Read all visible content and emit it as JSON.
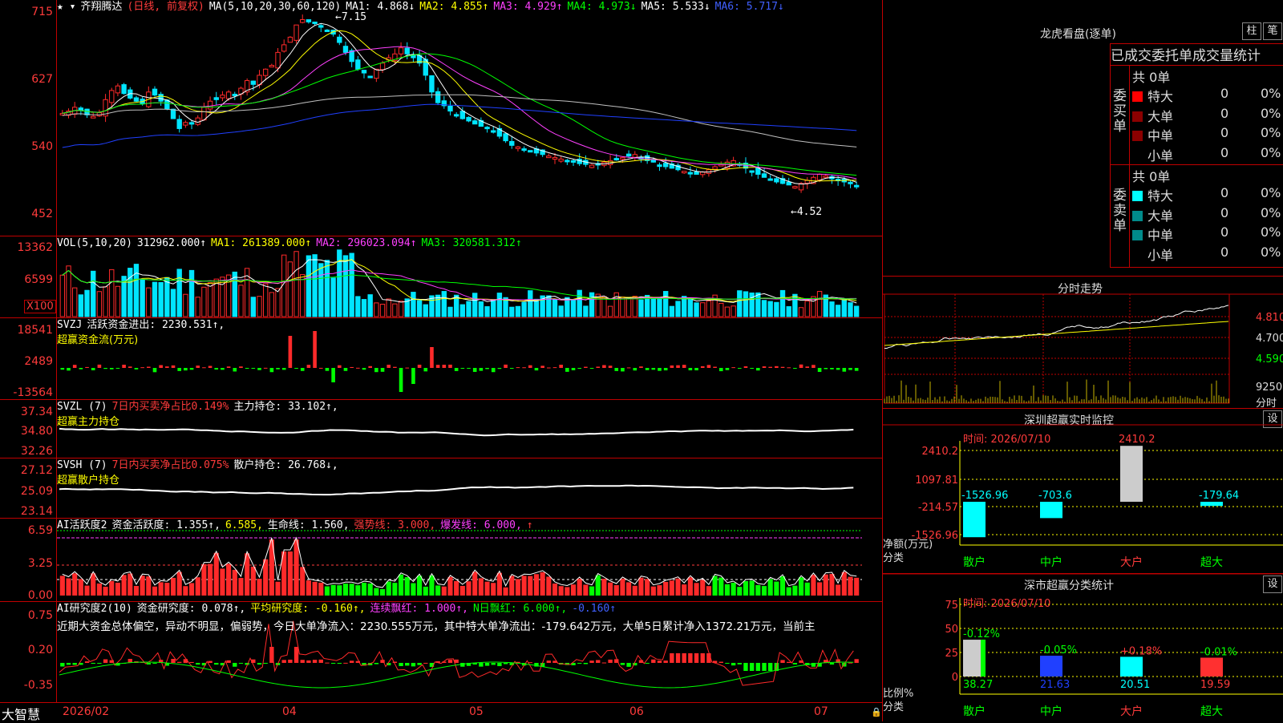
{
  "colors": {
    "up": "#ff2a2a",
    "down": "#00e5ff",
    "border": "#c00000"
  },
  "chart_data": [
    {
      "type": "candlestick",
      "panel": "price",
      "ylim": [
        452,
        715
      ],
      "yticks": [
        "715",
        "627",
        "540",
        "452"
      ],
      "close": [
        582,
        585,
        590,
        586,
        580,
        578,
        583,
        600,
        612,
        618,
        608,
        602,
        598,
        595,
        610,
        606,
        598,
        588,
        575,
        562,
        570,
        568,
        576,
        590,
        598,
        600,
        606,
        610,
        605,
        615,
        625,
        620,
        632,
        640,
        645,
        662,
        672,
        682,
        698,
        705,
        702,
        700,
        695,
        690,
        686,
        675,
        662,
        650,
        640,
        635,
        630,
        640,
        648,
        655,
        660,
        668,
        660,
        655,
        648,
        632,
        610,
        596,
        592,
        585,
        580,
        575,
        572,
        568,
        565,
        562,
        558,
        552,
        546,
        540,
        538,
        535,
        533,
        530,
        528,
        526,
        524,
        522,
        520,
        518,
        516,
        515,
        514,
        516,
        518,
        520,
        522,
        524,
        526,
        528,
        524,
        520,
        518,
        514,
        512,
        510,
        508,
        506,
        504,
        502,
        505,
        508,
        512,
        515,
        518,
        520,
        515,
        510,
        506,
        502,
        498,
        495,
        492,
        490,
        488,
        486,
        490,
        494,
        498,
        502,
        500,
        496,
        494,
        492,
        490,
        486
      ],
      "annotations": {
        "high_label": "←7.15",
        "low_label": "←4.52"
      }
    },
    {
      "type": "bar",
      "panel": "volume",
      "yticks": [
        "13362",
        "6599"
      ],
      "unit_badge": "X100"
    },
    {
      "type": "bar",
      "panel": "svzj",
      "yticks": [
        "18541",
        "2489",
        "-13564"
      ]
    },
    {
      "type": "line",
      "panel": "svzl",
      "yticks": [
        "37.34",
        "34.80",
        "32.26"
      ]
    },
    {
      "type": "line",
      "panel": "svsh",
      "yticks": [
        "27.12",
        "25.09",
        "23.14"
      ]
    },
    {
      "type": "bar",
      "panel": "ai_active",
      "yticks": [
        "6.59",
        "3.25",
        "0.00"
      ]
    },
    {
      "type": "bar",
      "panel": "ai_research",
      "yticks": [
        "0.75",
        "0.20",
        "-0.35"
      ]
    },
    {
      "type": "bar",
      "panel": "shenzhen_monitor",
      "yticks": [
        "2410.2",
        "1097.81",
        "-214.57",
        "-1526.96"
      ],
      "categories": [
        "散户",
        "中户",
        "大户",
        "超大"
      ],
      "values": [
        -1526.96,
        -703.6,
        2410.2,
        -179.64
      ],
      "labels": [
        "-1526.96",
        "-703.6",
        "2410.2",
        "-179.64"
      ]
    },
    {
      "type": "bar",
      "panel": "classification",
      "yticks": [
        "75",
        "50",
        "25",
        "0"
      ],
      "categories": [
        "散户",
        "中户",
        "大户",
        "超大"
      ],
      "values": [
        38.27,
        21.63,
        20.51,
        19.59
      ],
      "changes": [
        "-0.12%",
        "-0.05%",
        "+0.18%",
        "-0.01%"
      ]
    }
  ],
  "price_header": {
    "title": "齐翔腾达",
    "mode": "(日线, 前复权)",
    "ma_def": "MA(5,10,20,30,60,120)",
    "ma1": "MA1: 4.868↓",
    "ma2": "MA2: 4.855↑",
    "ma3": "MA3: 4.929↑",
    "ma4": "MA4: 4.973↓",
    "ma5": "MA5: 5.533↓",
    "ma6": "MA6: 5.717↓"
  },
  "vol_header": {
    "def": "VOL(5,10,20)",
    "val": "312962.000↑",
    "ma1": "MA1: 261389.000↑",
    "ma2": "MA2: 296023.094↑",
    "ma3": "MA3: 320581.312↑"
  },
  "svzj_header": {
    "def": "SVZJ",
    "name": "活跃资金进出: 2230.531↑,",
    "sub": "超赢资金流(万元)"
  },
  "svzl_header": {
    "def": "SVZL (7)",
    "ratio": "7日内买卖净占比0.149%",
    "hold": "主力持仓: 33.102↑,",
    "sub": "超赢主力持仓"
  },
  "svsh_header": {
    "def": "SVSH (7)",
    "ratio": "7日内买卖净占比0.075%",
    "hold": "散户持仓: 26.768↓,",
    "sub": "超赢散户持仓"
  },
  "ai1_header": {
    "def": "AI活跃度2",
    "a": "资金活跃度: 1.355↑,",
    "b": "6.585,",
    "c": "生命线: 1.560,",
    "d": "强势线: 3.000,",
    "e": "爆发线: 6.000,",
    "f": "↑"
  },
  "ai2_header": {
    "def": "AI研究度2(10)",
    "a": "资金研究度: 0.078↑,",
    "b": "平均研究度: -0.160↑,",
    "c": "连续飘红: 1.000↑,",
    "d": "N日飘红: 6.000↑,",
    "e": "-0.160↑"
  },
  "ai2_text": "近期大资金总体偏空，异动不明显，偏弱势，今日大单净流入：2230.555万元，其中特大单净流出：-179.642万元，大单5日累计净入1372.21万元，当前主",
  "xaxis": {
    "start": "2026/02",
    "m4": "04",
    "m5": "05",
    "m6": "06",
    "m7": "07"
  },
  "logo": "大智慧",
  "right": {
    "lhb_title": "龙虎看盘(逐单)",
    "btn1": "柱",
    "btn2": "笔",
    "stat_title": "已成交委托单成交量统计",
    "buy_label": "委买单",
    "sell_label": "委卖单",
    "buy_total": "共 0单",
    "sell_total": "共 0单",
    "rows": [
      {
        "name": "特大",
        "v": "0",
        "p": "0%"
      },
      {
        "name": "大单",
        "v": "0",
        "p": "0%"
      },
      {
        "name": "中单",
        "v": "0",
        "p": "0%"
      },
      {
        "name": "小单",
        "v": "0",
        "p": "0%"
      }
    ],
    "intraday_title": "分时走势",
    "intraday_ticks": [
      "4.810",
      "4.700",
      "4.590",
      "9250"
    ],
    "intraday_unit": "分时",
    "sz_title": "深圳超赢实时监控",
    "sz_btn": "设",
    "sz_time": "时间: 2026/07/10",
    "sz_ylab1": "净额(万元)",
    "sz_ylab2": "分类",
    "cls_title": "深市超赢分类统计",
    "cls_btn": "设",
    "cls_time": "时间: 2026/07/10",
    "cls_ylab1": "比例%",
    "cls_ylab2": "分类"
  }
}
